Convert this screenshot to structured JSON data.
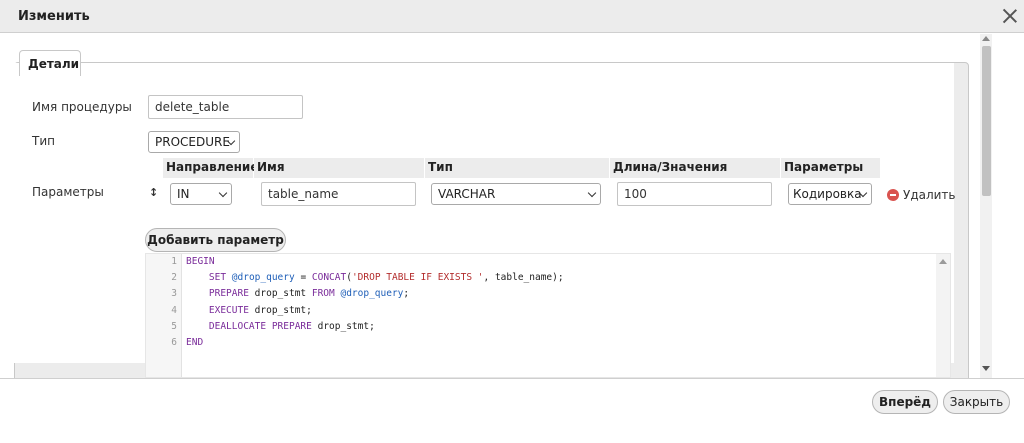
{
  "dialog": {
    "title": "Изменить"
  },
  "tabs": {
    "details": "Детали"
  },
  "form": {
    "procedure_name_label": "Имя процедуры",
    "procedure_name_value": "delete_table",
    "type_label": "Тип",
    "type_value": "PROCEDURE",
    "params_label": "Параметры"
  },
  "params_table": {
    "headers": [
      "Направление",
      "Имя",
      "Тип",
      "Длина/Значения",
      "Параметры"
    ],
    "rows": [
      {
        "direction": "IN",
        "name": "table_name",
        "type": "VARCHAR",
        "length": "100",
        "options": "Кодировка",
        "remove_label": "Удалить"
      }
    ],
    "move_glyph": "↕"
  },
  "add_param_button": "Добавить параметр",
  "editor": {
    "line_numbers": [
      "1",
      "2",
      "3",
      "4",
      "5",
      "6"
    ],
    "lines": [
      "BEGIN",
      "    SET @drop_query = CONCAT('DROP TABLE IF EXISTS ', table_name);",
      "    PREPARE drop_stmt FROM @drop_query;",
      "    EXECUTE drop_stmt;",
      "    DEALLOCATE PREPARE drop_stmt;",
      "END"
    ]
  },
  "footer": {
    "forward_button": "Вперёд",
    "close_button": "Закрыть"
  },
  "icons": {
    "close": "close-icon",
    "remove": "minus-circle-icon",
    "move": "move-arrows-icon",
    "dropdown": "chevron-down-icon"
  },
  "colors": {
    "remove_icon": "#d9534f",
    "keyword": "#7a2c9a",
    "variable": "#1f5fb8",
    "string": "#b32d2d"
  }
}
